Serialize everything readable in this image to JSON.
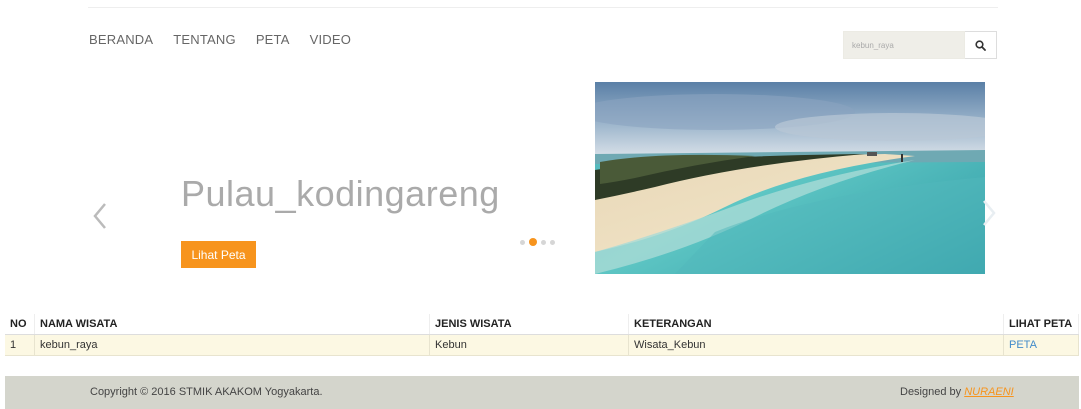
{
  "nav": {
    "items": [
      {
        "label": "BERANDA"
      },
      {
        "label": "TENTANG"
      },
      {
        "label": "PETA"
      },
      {
        "label": "VIDEO"
      }
    ]
  },
  "search": {
    "placeholder": "kebun_raya",
    "icon": "search-icon"
  },
  "slider": {
    "title": "Pulau_kodingareng",
    "button_label": "Lihat Peta",
    "dots_total": 4,
    "active_dot": 2,
    "accent": "#f7941d"
  },
  "table": {
    "headers": [
      "NO",
      "NAMA WISATA",
      "JENIS WISATA",
      "KETERANGAN",
      "LIHAT PETA"
    ],
    "rows": [
      {
        "no": "1",
        "nama": "kebun_raya",
        "jenis": "Kebun",
        "keterangan": "Wisata_Kebun",
        "lihat": "PETA"
      }
    ]
  },
  "footer": {
    "copyright": "Copyright © 2016 STMIK AKAKOM Yogyakarta.",
    "designed_prefix": "Designed by ",
    "designer": "NURAENI"
  }
}
